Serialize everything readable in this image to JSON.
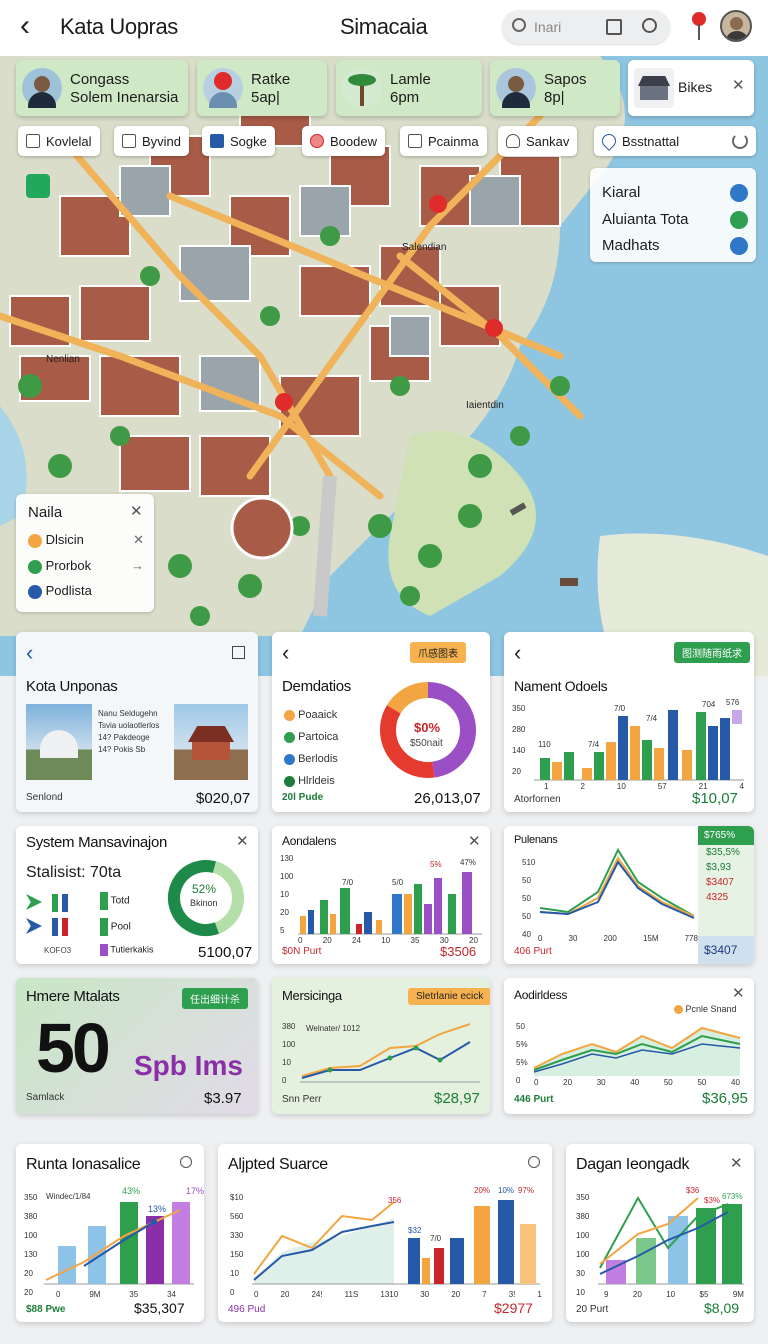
{
  "header": {
    "back": "‹",
    "title": "Kata Uopras",
    "center": "Simacaia",
    "search_placeholder": "Inari"
  },
  "events": [
    {
      "line1": "Congass",
      "line2": "Solem Inenarsia"
    },
    {
      "line1": "Ratke",
      "line2": "5ap|"
    },
    {
      "line1": "Lamle",
      "line2": "6pm"
    },
    {
      "line1": "Sapos",
      "line2": "8p|"
    },
    {
      "line1": "Bikes",
      "line2": ""
    }
  ],
  "chips": [
    "Kovlelal",
    "Byvind",
    "Sogke",
    "Boodew",
    "Pcainma",
    "Sankav",
    "Bsstnattal"
  ],
  "places": {
    "p1": "Kiaral",
    "p2": "Aluianta Tota",
    "p3": "Madhats"
  },
  "map_labels": {
    "a": "Salendian",
    "b": "Nenlian",
    "c": "Iaientdin"
  },
  "legend": {
    "title": "Naila",
    "items": [
      "Dlsicin",
      "Prorbok",
      "Podlista"
    ]
  },
  "c1": {
    "title": "Kota Unponas",
    "lines": [
      "Nanu Seldugehn",
      "Tsvia uolaotlerlos",
      "14? Pakdeoge",
      "14? Pokis Sb"
    ],
    "foot": "Senlond",
    "price": "$020,07"
  },
  "c2": {
    "title": "Demdatios",
    "badge": "爪感图表",
    "items": [
      "Poaaick",
      "Partoica",
      "Berlodis",
      "Hlrldeis"
    ],
    "donut_pct": "$0%",
    "donut_sub": "$50nait",
    "foot": "20l Pude",
    "price": "26,013,07"
  },
  "c3": {
    "title": "Nament Odoels",
    "badge": "图测随雨纸求",
    "ticks": [
      "350",
      "280",
      "140",
      "20"
    ],
    "labels": [
      "110",
      "7/0",
      "7/4",
      "7/4",
      "7/0",
      "704",
      "576"
    ],
    "xt": [
      "1",
      "2",
      "10",
      "57",
      "21",
      "4"
    ],
    "foot": "Atorfornen",
    "price": "$10,07"
  },
  "c4": {
    "title": "System Mansavinajon",
    "sub": "Stalisist:",
    "subv": "70ta",
    "donut_pct": "52%",
    "donut_sub": "Bkinon",
    "l1": "Totd",
    "l2": "Pool",
    "l3": "Tutierkakis",
    "ftxt": "KOFO3",
    "price": "5100,07"
  },
  "c5": {
    "title": "Aondalens",
    "ticks": [
      "130",
      "100",
      "10",
      "20",
      "5"
    ],
    "labels": [
      "7/0",
      "5/0",
      "5%",
      "47%"
    ],
    "xt": [
      "0",
      "20",
      "24",
      "10",
      "35",
      "30",
      "20"
    ],
    "foot": "$0N Purt",
    "price": "$3506"
  },
  "c6": {
    "title": "Pulenans",
    "ticks": [
      "510",
      "50",
      "50",
      "50",
      "40"
    ],
    "xt": [
      "0",
      "30",
      "200",
      "15M",
      "778"
    ],
    "side": [
      "$765%",
      "$35,5%",
      "$3,93",
      "$3407",
      "4325"
    ],
    "side_price": "$3407",
    "foot": "406 Purt"
  },
  "c7": {
    "title": "Hmere Mtalats",
    "badge": "任出细计杀",
    "big": "50",
    "unit": "Spb Ims",
    "foot": "Samlack",
    "price": "$3.97"
  },
  "c8": {
    "title": "Mersicinga",
    "badge": "Sletrlanie ecick",
    "inner": "Welnater/ 1012",
    "ticks": [
      "380",
      "100",
      "10",
      "0"
    ],
    "foot": "Snn Perr",
    "price": "$28,97"
  },
  "c9": {
    "title": "Aodirldess",
    "legend": "Pcnle Snand",
    "ticks": [
      "50",
      "5%",
      "5%",
      "0"
    ],
    "xt": [
      "0",
      "20",
      "30",
      "40",
      "50",
      "50",
      "40"
    ],
    "foot": "446 Purt",
    "price": "$36,95"
  },
  "c10": {
    "title": "Runta Ionasalice",
    "inner": "Windec/1/84",
    "labels": [
      "43%",
      "17%",
      "13%"
    ],
    "ticks": [
      "350",
      "380",
      "100",
      "130",
      "20",
      "20"
    ],
    "xt": [
      "0",
      "9M",
      "35",
      "34"
    ],
    "foot": "$88 Pwe",
    "price": "$35,307"
  },
  "c11": {
    "title": "Aljpted Suarce",
    "labels": [
      "356",
      "20%",
      "10%",
      "97%",
      "$32",
      "7/0"
    ],
    "ticks": [
      "$10",
      "560",
      "330",
      "150",
      "10",
      "0"
    ],
    "xt": [
      "0",
      "20",
      "24!",
      "11S",
      "1310",
      "30",
      "20",
      "7",
      "3!",
      "1"
    ],
    "foot": "496 Pud",
    "price": "$2977"
  },
  "c12": {
    "title": "Dagan Ieongadk",
    "labels": [
      "$36",
      "$3%",
      "673%"
    ],
    "ticks": [
      "350",
      "380",
      "100",
      "100",
      "30",
      "10"
    ],
    "xt": [
      "9",
      "20",
      "10",
      "$5",
      "9M"
    ],
    "foot": "20 Purt",
    "price": "$8,09"
  },
  "colors": {
    "green": "#2e9e4f",
    "blue": "#2659a8",
    "orange": "#f2a541",
    "purple": "#9b4fc4",
    "red": "#e02b2b",
    "navy": "#1f3a7a"
  }
}
